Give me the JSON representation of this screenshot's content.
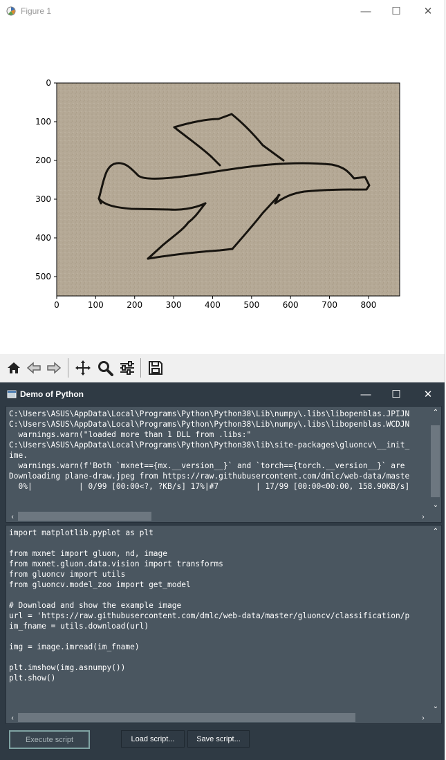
{
  "figure_window": {
    "title": "Figure 1",
    "controls": [
      "—",
      "☐",
      "✕"
    ]
  },
  "chart_data": {
    "type": "image",
    "x_ticks": [
      "0",
      "100",
      "200",
      "300",
      "400",
      "500",
      "600",
      "700",
      "800"
    ],
    "y_ticks": [
      "0",
      "100",
      "200",
      "300",
      "400",
      "500"
    ],
    "xlim": [
      0,
      880
    ],
    "ylim": [
      550,
      0
    ],
    "image_content": "hand-drawn airplane sketch on cardboard"
  },
  "toolbar": {
    "tools": [
      "home-icon",
      "back-icon",
      "forward-icon",
      "pan-icon",
      "zoom-icon",
      "configure-icon",
      "save-icon"
    ]
  },
  "demo_window": {
    "title": "Demo of Python",
    "controls": [
      "—",
      "☐",
      "✕"
    ]
  },
  "output": {
    "lines": [
      "C:\\Users\\ASUS\\AppData\\Local\\Programs\\Python\\Python38\\Lib\\numpy\\.libs\\libopenblas.JPIJN",
      "C:\\Users\\ASUS\\AppData\\Local\\Programs\\Python\\Python38\\Lib\\numpy\\.libs\\libopenblas.WCDJN",
      "  warnings.warn(\"loaded more than 1 DLL from .libs:\"",
      "C:\\Users\\ASUS\\AppData\\Local\\Programs\\Python\\Python38\\lib\\site-packages\\gluoncv\\__init_",
      "ime.",
      "  warnings.warn(f'Both `mxnet=={mx.__version__}` and `torch=={torch.__version__}` are",
      "Downloading plane-draw.jpeg from https://raw.githubusercontent.com/dmlc/web-data/maste",
      "  0%|          | 0/99 [00:00<?, ?KB/s] 17%|#7        | 17/99 [00:00<00:00, 158.90KB/s]"
    ]
  },
  "script": {
    "lines": [
      "import matplotlib.pyplot as plt",
      "",
      "from mxnet import gluon, nd, image",
      "from mxnet.gluon.data.vision import transforms",
      "from gluoncv import utils",
      "from gluoncv.model_zoo import get_model",
      "",
      "# Download and show the example image",
      "url = 'https://raw.githubusercontent.com/dmlc/web-data/master/gluoncv/classification/p",
      "im_fname = utils.download(url)",
      "",
      "img = image.imread(im_fname)",
      "",
      "plt.imshow(img.asnumpy())",
      "plt.show()"
    ]
  },
  "buttons": {
    "execute": "Execute script",
    "load": "Load script...",
    "save": "Save script..."
  }
}
